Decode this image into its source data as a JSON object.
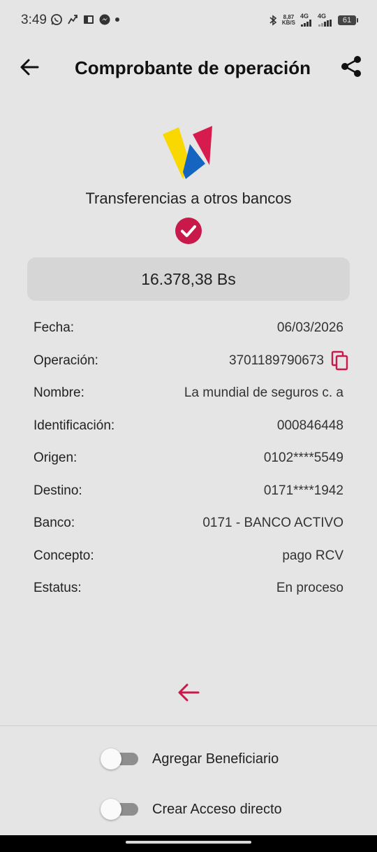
{
  "status_bar": {
    "time": "3:49",
    "speed_value": "8,87",
    "speed_unit": "KB/S",
    "net1": "4G",
    "net2": "4G",
    "battery": "61",
    "icons": [
      "whatsapp-icon",
      "activity-icon",
      "document-icon",
      "messenger-icon",
      "dot-icon",
      "bluetooth-icon",
      "signal-icon",
      "signal-icon",
      "battery-icon"
    ]
  },
  "header": {
    "title": "Comprobante de operación",
    "back_icon": "arrow-left-icon",
    "share_icon": "share-icon"
  },
  "service": {
    "name": "Transferencias a otros bancos",
    "status_icon": "check-circle-icon"
  },
  "amount": "16.378,38 Bs",
  "details": [
    {
      "label": "Fecha:",
      "value": "06/03/2026"
    },
    {
      "label": "Operación:",
      "value": "3701189790673"
    },
    {
      "label": "Nombre:",
      "value": "La mundial de seguros c. a"
    },
    {
      "label": "Identificación:",
      "value": "000846448"
    },
    {
      "label": "Origen:",
      "value": "0102****5549"
    },
    {
      "label": "Destino:",
      "value": "0171****1942"
    },
    {
      "label": "Banco:",
      "value": "0171 - BANCO ACTIVO"
    },
    {
      "label": "Concepto:",
      "value": "pago RCV"
    },
    {
      "label": "Estatus:",
      "value": "En proceso"
    }
  ],
  "toggles": [
    {
      "label": "Agregar Beneficiario",
      "on": false
    },
    {
      "label": "Crear Acceso directo",
      "on": false
    }
  ],
  "colors": {
    "accent": "#c8194a",
    "background": "#e5e5e5",
    "amount_box": "#d6d6d6"
  }
}
